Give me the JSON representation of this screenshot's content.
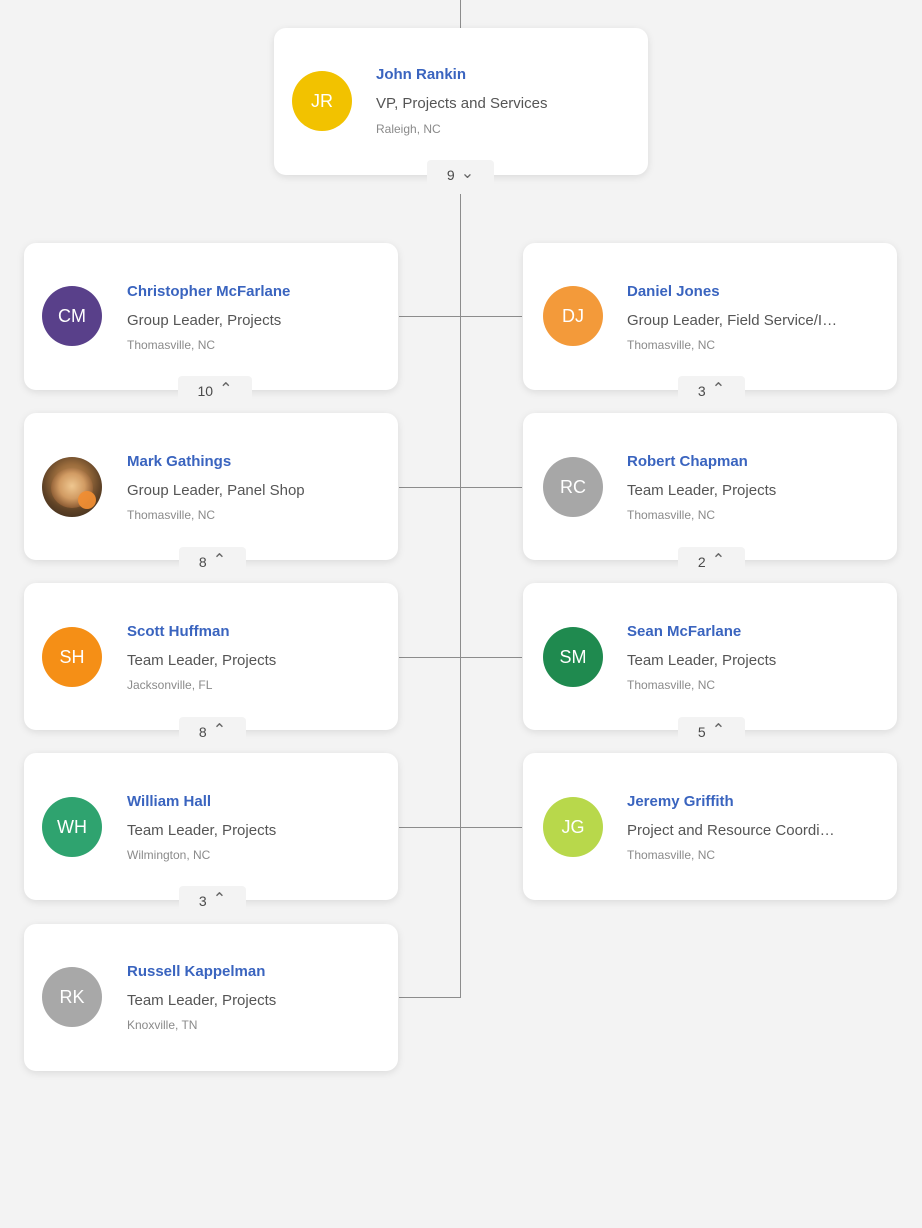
{
  "top": {
    "name": "John Rankin",
    "title": "VP, Projects and Services",
    "location": "Raleigh, NC",
    "initials": "JR",
    "avatar_color": "#f2c200",
    "count": "9",
    "chevron": "⌄"
  },
  "cards": [
    {
      "name": "Christopher McFarlane",
      "title": "Group Leader, Projects",
      "location": "Thomasville, NC",
      "initials": "CM",
      "avatar_color": "#59408a",
      "count": "10",
      "chevron": "⌃"
    },
    {
      "name": "Daniel Jones",
      "title": "Group Leader, Field Service/I…",
      "location": "Thomasville, NC",
      "initials": "DJ",
      "avatar_color": "#f39a3a",
      "count": "3",
      "chevron": "⌃"
    },
    {
      "name": "Mark Gathings",
      "title": "Group Leader, Panel Shop",
      "location": "Thomasville, NC",
      "initials": "",
      "avatar_color": "#7b5d35",
      "count": "8",
      "chevron": "⌃"
    },
    {
      "name": "Robert Chapman",
      "title": "Team Leader, Projects",
      "location": "Thomasville, NC",
      "initials": "RC",
      "avatar_color": "#a7a7a7",
      "count": "2",
      "chevron": "⌃"
    },
    {
      "name": "Scott Huffman",
      "title": "Team Leader, Projects",
      "location": "Jacksonville, FL",
      "initials": "SH",
      "avatar_color": "#f58f16",
      "count": "8",
      "chevron": "⌃"
    },
    {
      "name": "Sean McFarlane",
      "title": "Team Leader, Projects",
      "location": "Thomasville, NC",
      "initials": "SM",
      "avatar_color": "#1f8a4f",
      "count": "5",
      "chevron": "⌃"
    },
    {
      "name": "William Hall",
      "title": "Team Leader, Projects",
      "location": "Wilmington, NC",
      "initials": "WH",
      "avatar_color": "#2fa36f",
      "count": "3",
      "chevron": "⌃"
    },
    {
      "name": "Jeremy Griffith",
      "title": "Project and Resource Coordi…",
      "location": "Thomasville, NC",
      "initials": "JG",
      "avatar_color": "#b8d84b",
      "count": "",
      "chevron": ""
    },
    {
      "name": "Russell Kappelman",
      "title": "Team Leader, Projects",
      "location": "Knoxville, TN",
      "initials": "RK",
      "avatar_color": "#a8a8a8",
      "count": "",
      "chevron": ""
    }
  ]
}
